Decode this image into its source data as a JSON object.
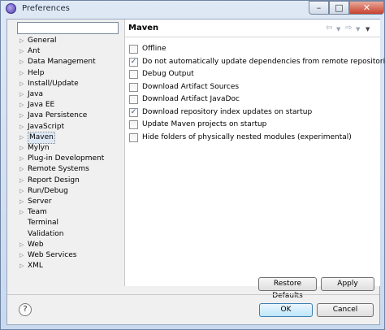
{
  "window": {
    "title": "Preferences",
    "minimize_glyph": "–",
    "maximize_glyph": "□",
    "close_glyph": "✕"
  },
  "filter": {
    "value": "",
    "placeholder": ""
  },
  "tree": {
    "items": [
      {
        "label": "General",
        "expandable": true,
        "selected": false
      },
      {
        "label": "Ant",
        "expandable": true,
        "selected": false
      },
      {
        "label": "Data Management",
        "expandable": true,
        "selected": false
      },
      {
        "label": "Help",
        "expandable": true,
        "selected": false
      },
      {
        "label": "Install/Update",
        "expandable": true,
        "selected": false
      },
      {
        "label": "Java",
        "expandable": true,
        "selected": false
      },
      {
        "label": "Java EE",
        "expandable": true,
        "selected": false
      },
      {
        "label": "Java Persistence",
        "expandable": true,
        "selected": false
      },
      {
        "label": "JavaScript",
        "expandable": true,
        "selected": false
      },
      {
        "label": "Maven",
        "expandable": true,
        "selected": true
      },
      {
        "label": "Mylyn",
        "expandable": true,
        "selected": false
      },
      {
        "label": "Plug-in Development",
        "expandable": true,
        "selected": false
      },
      {
        "label": "Remote Systems",
        "expandable": true,
        "selected": false
      },
      {
        "label": "Report Design",
        "expandable": true,
        "selected": false
      },
      {
        "label": "Run/Debug",
        "expandable": true,
        "selected": false
      },
      {
        "label": "Server",
        "expandable": true,
        "selected": false
      },
      {
        "label": "Team",
        "expandable": true,
        "selected": false
      },
      {
        "label": "Terminal",
        "expandable": false,
        "selected": false
      },
      {
        "label": "Validation",
        "expandable": false,
        "selected": false
      },
      {
        "label": "Web",
        "expandable": true,
        "selected": false
      },
      {
        "label": "Web Services",
        "expandable": true,
        "selected": false
      },
      {
        "label": "XML",
        "expandable": true,
        "selected": false
      }
    ]
  },
  "page": {
    "title": "Maven",
    "nav_icons": [
      "back-arrow-icon",
      "back-menu-icon",
      "forward-arrow-icon",
      "forward-menu-icon",
      "view-menu-icon"
    ],
    "options": [
      {
        "label": "Offline",
        "checked": false
      },
      {
        "label": "Do not automatically update dependencies from remote repositories",
        "checked": true
      },
      {
        "label": "Debug Output",
        "checked": false
      },
      {
        "label": "Download Artifact Sources",
        "checked": false
      },
      {
        "label": "Download Artifact JavaDoc",
        "checked": false
      },
      {
        "label": "Download repository index updates on startup",
        "checked": true
      },
      {
        "label": "Update Maven projects on startup",
        "checked": false
      },
      {
        "label": "Hide folders of physically nested modules (experimental)",
        "checked": false
      }
    ]
  },
  "buttons": {
    "restore_defaults": "Restore Defaults",
    "apply": "Apply",
    "ok": "OK",
    "cancel": "Cancel",
    "help_glyph": "?"
  }
}
